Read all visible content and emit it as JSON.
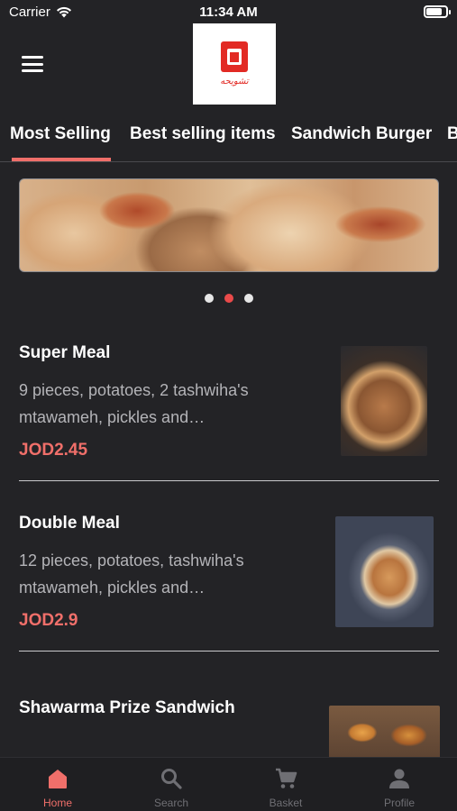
{
  "status_bar": {
    "carrier": "Carrier",
    "time": "11:34 AM",
    "battery_level": 0.9
  },
  "header": {
    "menu_icon": "hamburger-icon",
    "logo_icon": "brand-logo",
    "logo_text": "تشويحه"
  },
  "tabs": [
    {
      "label": "Most Selling",
      "active": true
    },
    {
      "label": "Best selling items",
      "active": false
    },
    {
      "label": "Sandwich Burger",
      "active": false
    },
    {
      "label": "B",
      "active": false
    }
  ],
  "carousel": {
    "page_count": 3,
    "active_index": 1
  },
  "items": [
    {
      "name": "Super Meal",
      "desc_line1": "9 pieces, potatoes, 2 tashwiha's",
      "desc_line2": "mtawameh, pickles and…",
      "price": "JOD2.45"
    },
    {
      "name": "Double Meal",
      "desc_line1": "12 pieces, potatoes, tashwiha's",
      "desc_line2": "mtawameh, pickles and…",
      "price": "JOD2.9"
    },
    {
      "name": "Shawarma Prize Sandwich"
    }
  ],
  "bottom_nav": [
    {
      "label": "Home",
      "icon": "home-icon",
      "active": true
    },
    {
      "label": "Search",
      "icon": "search-icon",
      "active": false
    },
    {
      "label": "Basket",
      "icon": "cart-icon",
      "active": false
    },
    {
      "label": "Profile",
      "icon": "profile-icon",
      "active": false
    }
  ],
  "colors": {
    "background": "#232326",
    "accent": "#f06f6a",
    "nav_active": "#f06f6a",
    "nav_inactive": "#6f6f74",
    "text_secondary": "#b4b4b8"
  }
}
